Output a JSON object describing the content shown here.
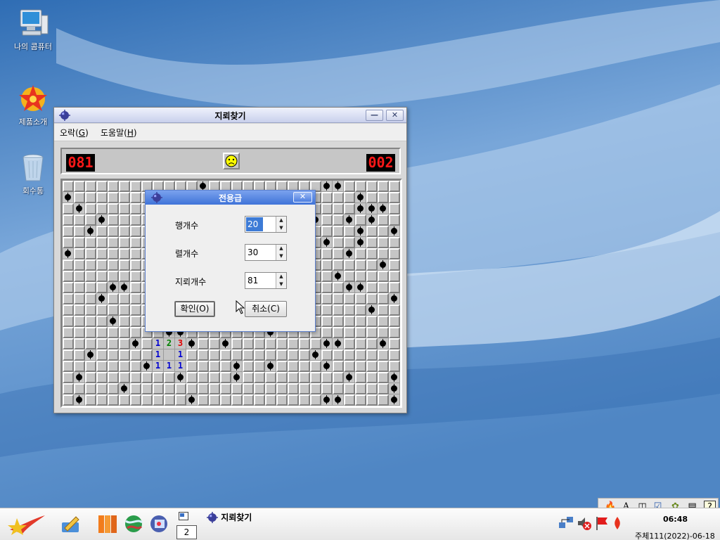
{
  "desktop": {
    "icons": [
      {
        "label": "나의 콤퓨터"
      },
      {
        "label": "제품소개"
      },
      {
        "label": "회수통"
      }
    ]
  },
  "game_window": {
    "title": "지뢰찾기",
    "minimize_glyph": "—",
    "close_glyph": "✕",
    "menu": [
      {
        "label": "오락(",
        "key": "G",
        "end": ")"
      },
      {
        "label": "도움말(",
        "key": "H",
        "end": ")"
      }
    ],
    "mine_counter": "081",
    "timer": "002",
    "face": "frown",
    "rows": 20,
    "cols": 30,
    "numbers": [
      {
        "r": 14,
        "c": 8,
        "n": "1",
        "color": "#0000d0"
      },
      {
        "r": 14,
        "c": 9,
        "n": "2",
        "color": "#008000"
      },
      {
        "r": 14,
        "c": 10,
        "n": "3",
        "color": "#e00000"
      },
      {
        "r": 15,
        "c": 8,
        "n": "1",
        "color": "#0000d0"
      },
      {
        "r": 15,
        "c": 10,
        "n": "1",
        "color": "#0000d0"
      },
      {
        "r": 16,
        "c": 8,
        "n": "1",
        "color": "#0000d0"
      },
      {
        "r": 16,
        "c": 9,
        "n": "1",
        "color": "#0000d0"
      },
      {
        "r": 16,
        "c": 10,
        "n": "1",
        "color": "#0000d0"
      }
    ],
    "open_cells": [
      [
        15,
        9
      ]
    ],
    "mines": [
      [
        0,
        12
      ],
      [
        0,
        23
      ],
      [
        0,
        24
      ],
      [
        1,
        0
      ],
      [
        1,
        26
      ],
      [
        2,
        1
      ],
      [
        2,
        26
      ],
      [
        2,
        27
      ],
      [
        2,
        28
      ],
      [
        3,
        3
      ],
      [
        3,
        22
      ],
      [
        3,
        25
      ],
      [
        3,
        27
      ],
      [
        4,
        2
      ],
      [
        4,
        26
      ],
      [
        4,
        29
      ],
      [
        5,
        23
      ],
      [
        5,
        26
      ],
      [
        6,
        0
      ],
      [
        6,
        25
      ],
      [
        7,
        28
      ],
      [
        8,
        24
      ],
      [
        9,
        4
      ],
      [
        9,
        5
      ],
      [
        9,
        25
      ],
      [
        9,
        26
      ],
      [
        10,
        3
      ],
      [
        10,
        29
      ],
      [
        11,
        27
      ],
      [
        12,
        4
      ],
      [
        13,
        9
      ],
      [
        13,
        10
      ],
      [
        13,
        18
      ],
      [
        14,
        6
      ],
      [
        14,
        11
      ],
      [
        14,
        14
      ],
      [
        14,
        23
      ],
      [
        14,
        24
      ],
      [
        14,
        28
      ],
      [
        15,
        2
      ],
      [
        15,
        22
      ],
      [
        16,
        7
      ],
      [
        16,
        15
      ],
      [
        16,
        18
      ],
      [
        16,
        23
      ],
      [
        17,
        1
      ],
      [
        17,
        10
      ],
      [
        17,
        15
      ],
      [
        17,
        25
      ],
      [
        17,
        29
      ],
      [
        18,
        5
      ],
      [
        18,
        29
      ],
      [
        19,
        1
      ],
      [
        19,
        11
      ],
      [
        19,
        23
      ],
      [
        19,
        24
      ],
      [
        19,
        29
      ]
    ]
  },
  "dialog": {
    "title": "전용급",
    "close_glyph": "✕",
    "fields": [
      {
        "label": "행개수",
        "value": "20"
      },
      {
        "label": "렬개수",
        "value": "30"
      },
      {
        "label": "지뢰개수",
        "value": "81"
      }
    ],
    "ok_label": "확인(O)",
    "cancel_label": "취소(C)"
  },
  "taskbar": {
    "pager_value": "2",
    "task_label": "지뢰찾기",
    "clock_time": "06:48",
    "clock_date": "주체111(2022)-06-18"
  },
  "ime": {
    "items": [
      "🔥",
      "A",
      "◫",
      "☑",
      "✿",
      "▤",
      "?"
    ]
  },
  "colors": {
    "desktop_blue": "#5f93cc",
    "dialog_title": "#3f73d8",
    "lcd_red": "#ff1818"
  }
}
